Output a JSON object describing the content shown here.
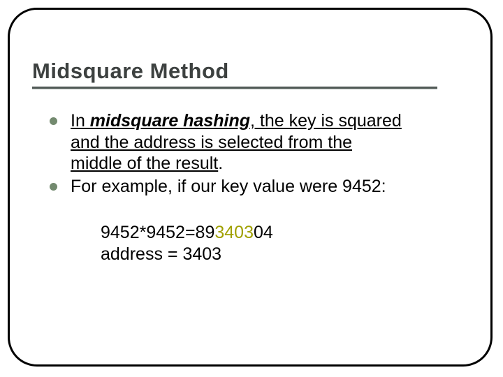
{
  "slide": {
    "title": "Midsquare Method",
    "bullets": [
      {
        "lead": "In ",
        "term": "midsquare hashing",
        "rest1": ", the key is squared",
        "line2": "and the address is selected from the",
        "line3": "middle of the result",
        "period": "."
      },
      {
        "text": "For example, if our key value were 9452:"
      }
    ],
    "calc": {
      "prefix": "9452*9452=89",
      "mid": "3403",
      "suffix": "04",
      "addr_label": "address = ",
      "addr_value": "3403"
    }
  }
}
